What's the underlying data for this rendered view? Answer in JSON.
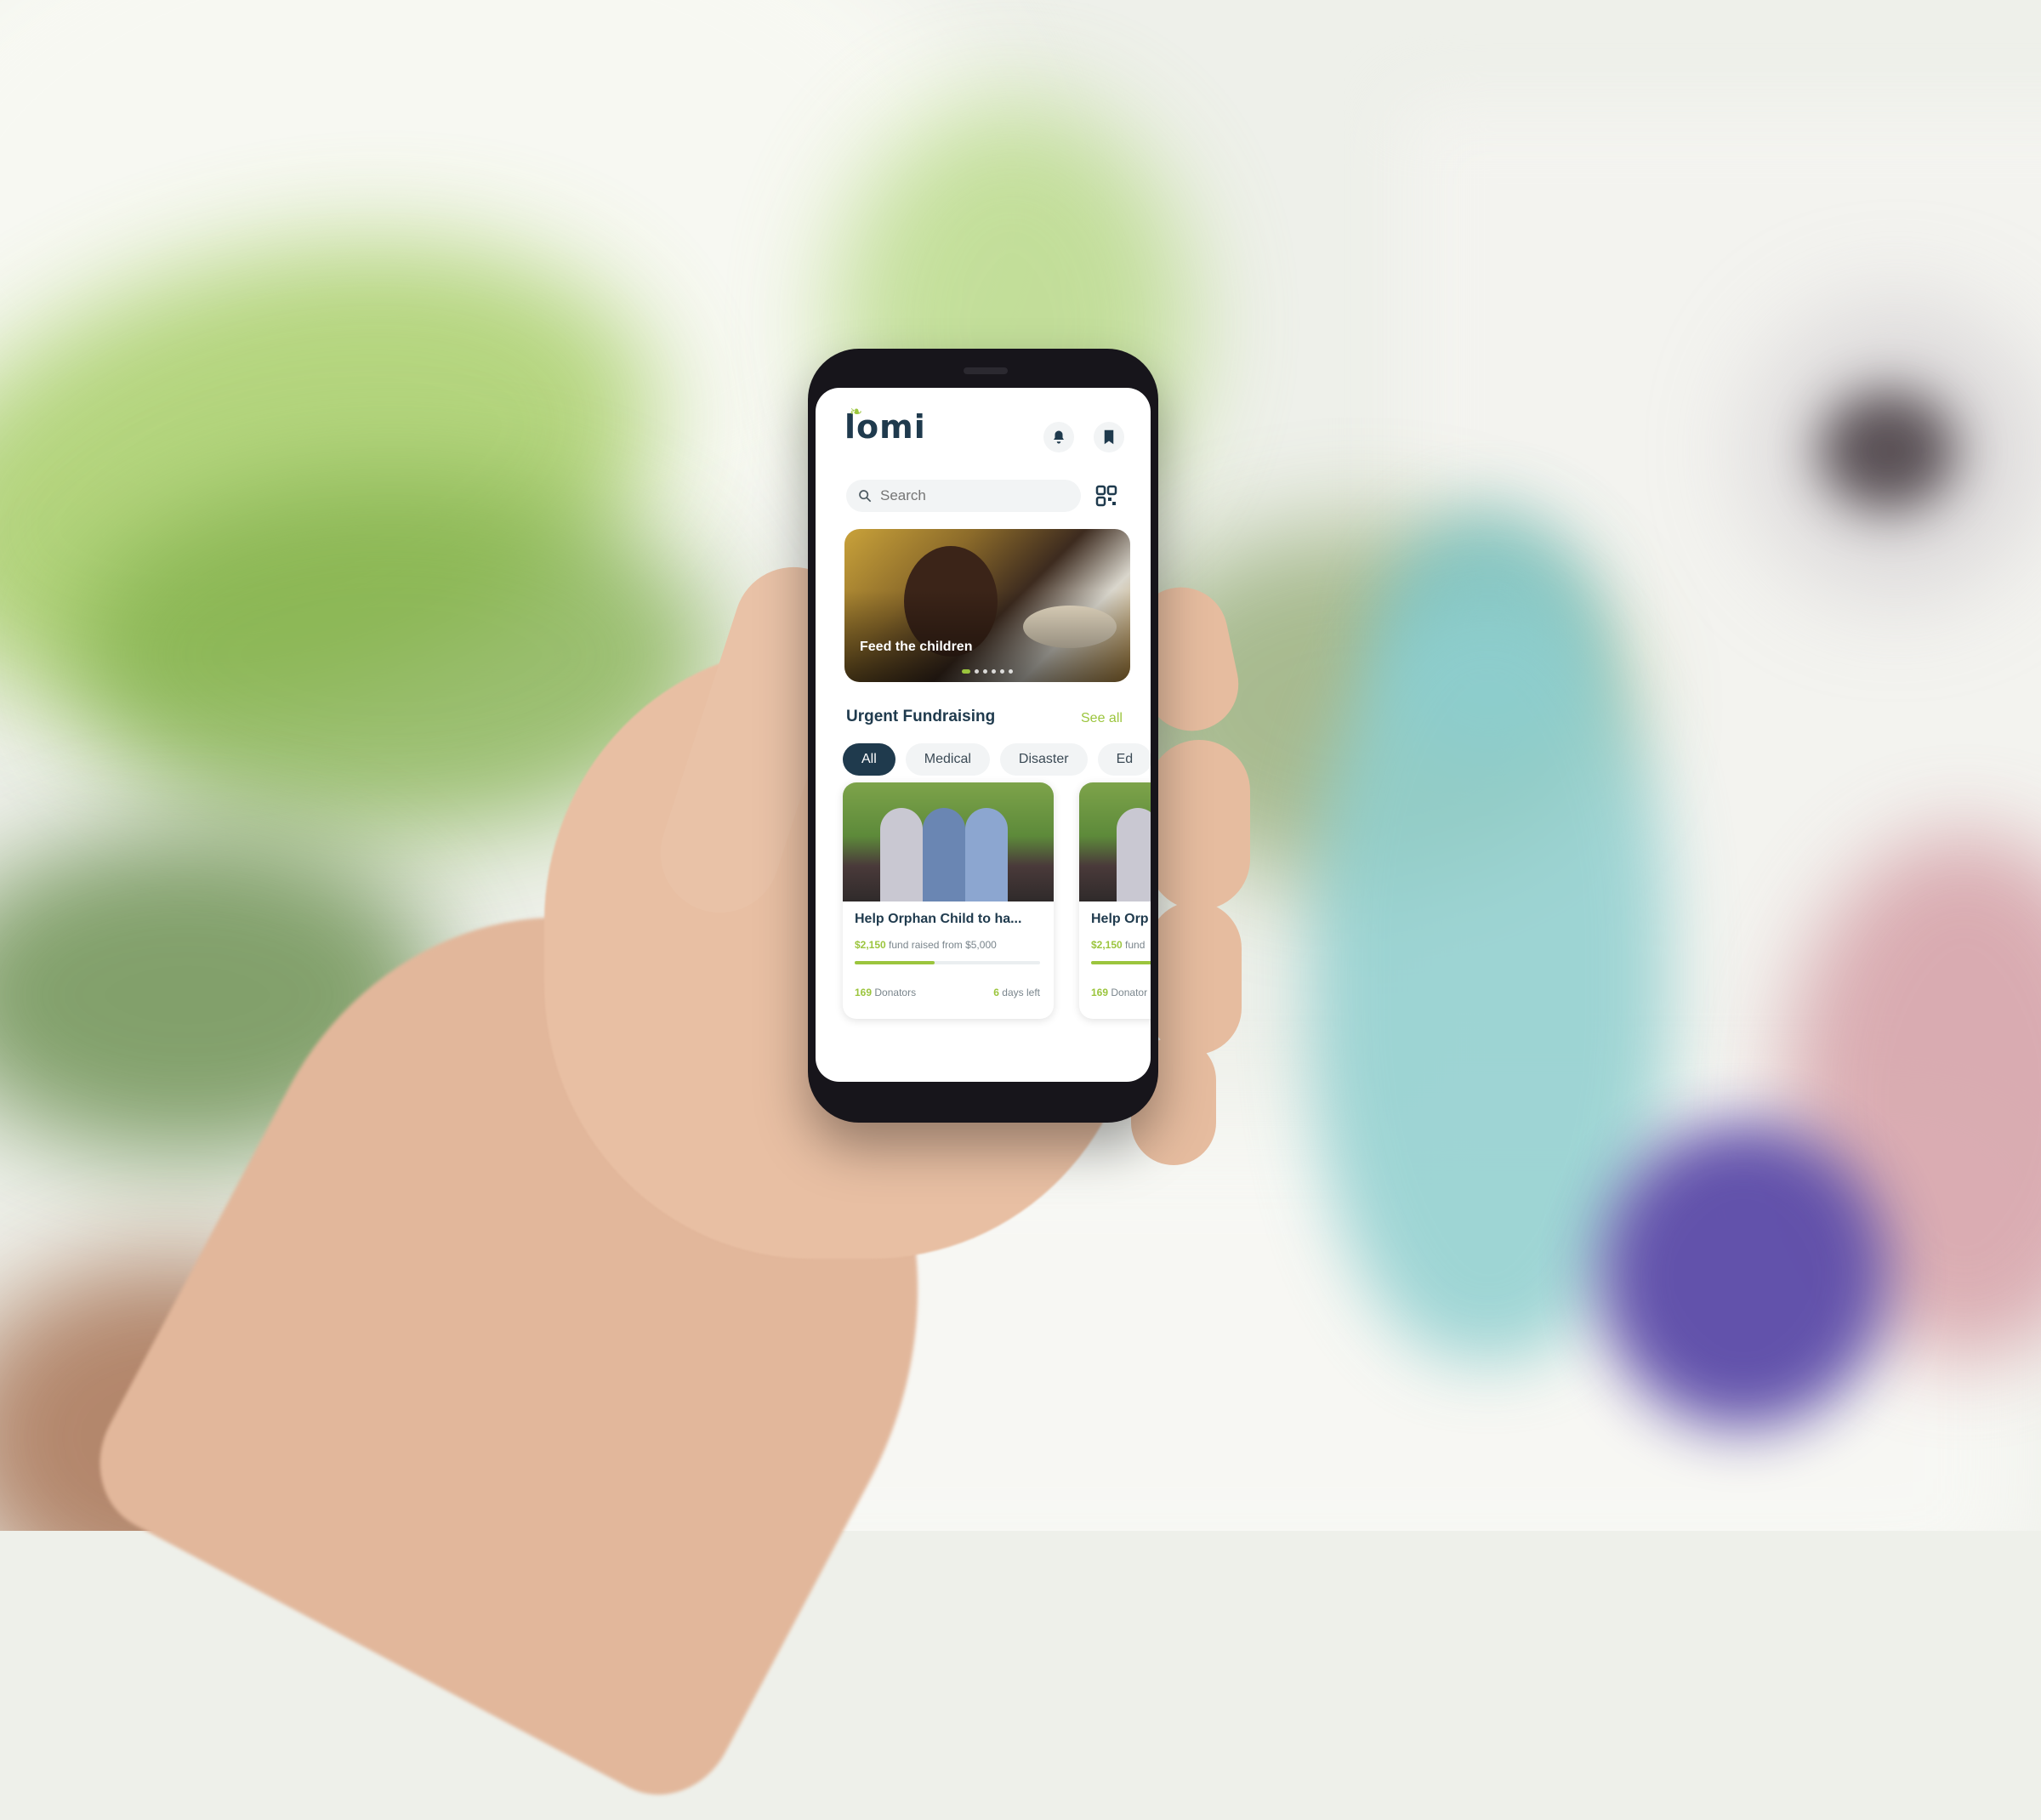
{
  "app": {
    "logo": "lomi"
  },
  "header": {
    "notifications_icon": "bell-icon",
    "bookmarks_icon": "bookmark-icon"
  },
  "search": {
    "placeholder": "Search",
    "value": "",
    "scan_icon": "qr-scan-icon"
  },
  "banner": {
    "caption": "Feed the children",
    "slides": 6,
    "active_slide": 1
  },
  "urgent": {
    "title": "Urgent Fundraising",
    "see_all": "See all"
  },
  "categories": [
    "All",
    "Medical",
    "Disaster",
    "Ed"
  ],
  "cards": [
    {
      "title": "Help Orphan Child to ha...",
      "amount": "$2,150",
      "raised_text": "fund raised from $5,000",
      "progress": 0.43,
      "donators_count": "169",
      "donators_label": "Donators",
      "days_count": "6",
      "days_label": "days left"
    },
    {
      "title": "Help Orp",
      "amount": "$2,150",
      "raised_text": "fund",
      "progress": 0.43,
      "donators_count": "169",
      "donators_label": "Donator",
      "days_count": "",
      "days_label": ""
    }
  ],
  "colors": {
    "brand": "#1f3a4d",
    "accent": "#9bc53d"
  }
}
